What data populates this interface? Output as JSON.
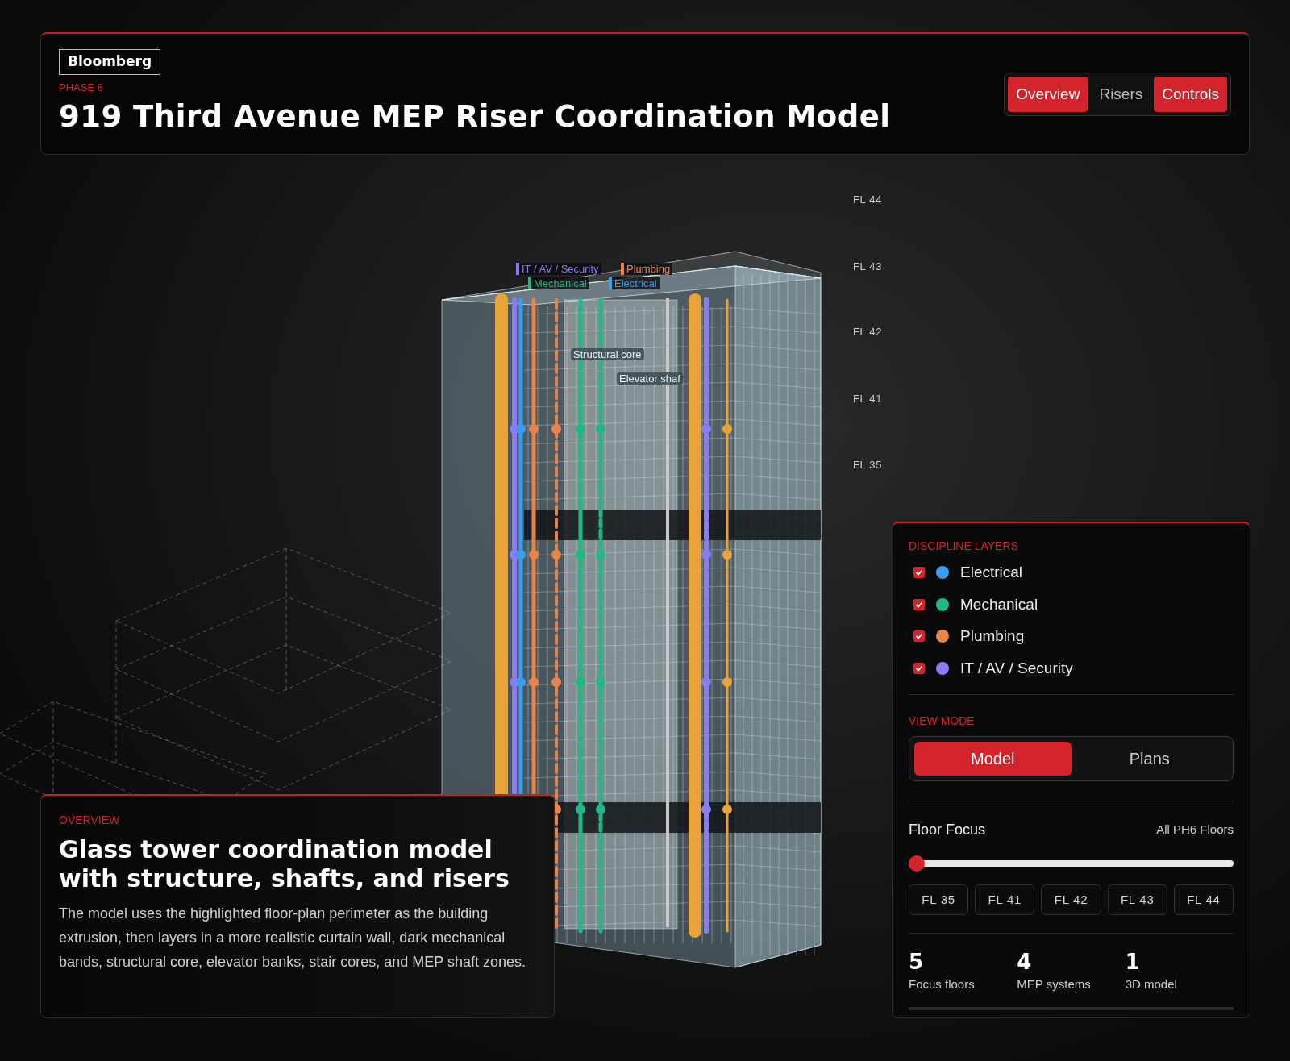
{
  "header": {
    "logo": "Bloomberg",
    "eyebrow": "PHASE 6",
    "title": "919 Third Avenue MEP Riser Coordination Model",
    "tabs": [
      {
        "label": "Overview",
        "selected": true
      },
      {
        "label": "Risers",
        "selected": false
      },
      {
        "label": "Controls",
        "selected": true
      }
    ]
  },
  "scene": {
    "floor_labels": [
      "FL 44",
      "FL 43",
      "FL 42",
      "FL 41",
      "FL 35"
    ],
    "riser_labels": [
      {
        "label": "IT / AV / Security",
        "color": "#8b7cf6"
      },
      {
        "label": "Plumbing",
        "color": "#e8834a"
      },
      {
        "label": "Mechanical",
        "color": "#22b884"
      },
      {
        "label": "Electrical",
        "color": "#3b9cf0"
      }
    ],
    "element_labels": [
      "Structural core",
      "Elevator shaf"
    ]
  },
  "overview": {
    "eyebrow": "OVERVIEW",
    "title": "Glass tower coordination model with structure, shafts, and risers",
    "body": "The model uses the highlighted floor-plan perimeter as the building extrusion, then layers in a more realistic curtain wall, dark mechanical bands, structural core, elevator banks, stair cores, and MEP shaft zones."
  },
  "panel": {
    "layers_title": "DISCIPLINE LAYERS",
    "layers": [
      {
        "label": "Electrical",
        "checked": true,
        "color": "#3b9cf0"
      },
      {
        "label": "Mechanical",
        "checked": true,
        "color": "#22b884"
      },
      {
        "label": "Plumbing",
        "checked": true,
        "color": "#e8834a"
      },
      {
        "label": "IT / AV / Security",
        "checked": true,
        "color": "#8b7cf6"
      }
    ],
    "view_mode_title": "VIEW MODE",
    "view_modes": [
      {
        "label": "Model",
        "selected": true
      },
      {
        "label": "Plans",
        "selected": false
      }
    ],
    "floor_focus": {
      "label": "Floor Focus",
      "value": "All PH6 Floors",
      "level": 0
    },
    "floors": [
      "FL 35",
      "FL 41",
      "FL 42",
      "FL 43",
      "FL 44"
    ],
    "stats": [
      {
        "value": "5",
        "label": "Focus floors"
      },
      {
        "value": "4",
        "label": "MEP systems"
      },
      {
        "value": "1",
        "label": "3D model"
      }
    ]
  }
}
